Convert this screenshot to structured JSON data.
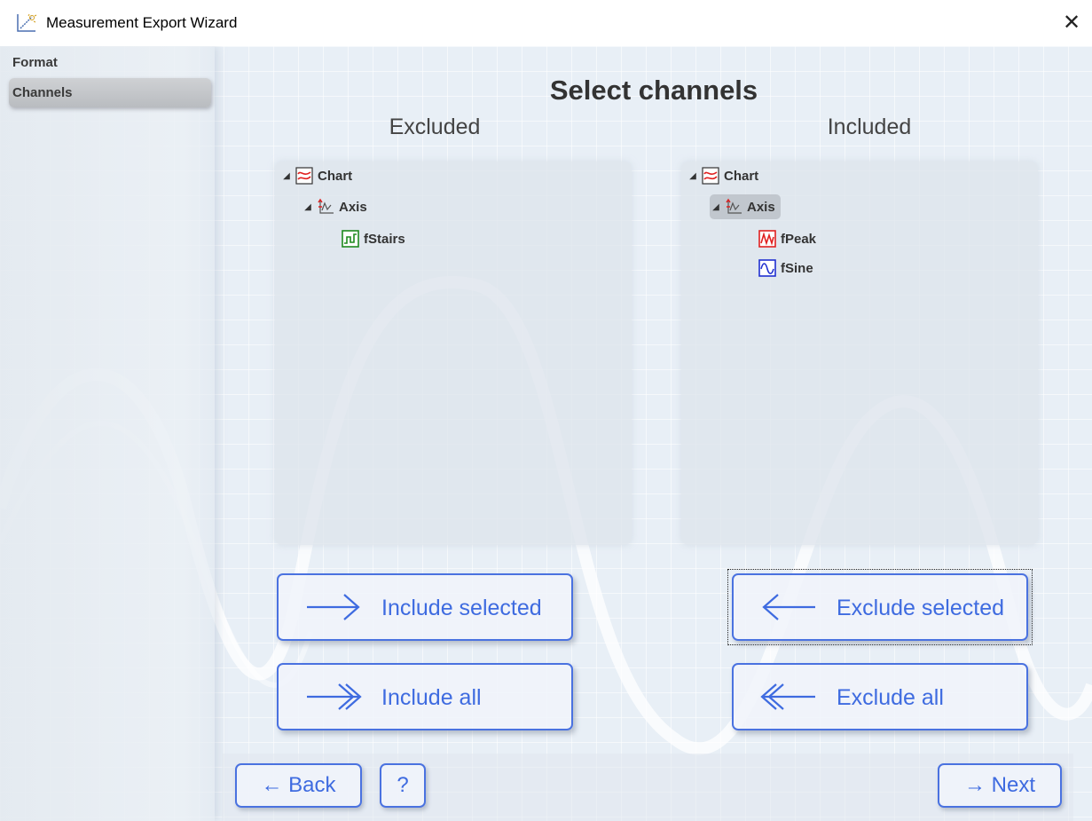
{
  "window": {
    "title": "Measurement Export Wizard",
    "close_glyph": "✕",
    "app_icon": "chart-wizard-icon"
  },
  "sidebar": {
    "items": [
      {
        "label": "Format",
        "active": false
      },
      {
        "label": "Channels",
        "active": true
      }
    ]
  },
  "main": {
    "title": "Select channels",
    "excluded_header": "Excluded",
    "included_header": "Included"
  },
  "excluded_tree": {
    "chart": {
      "label": "Chart",
      "expander": "◢",
      "icon": "chart-icon"
    },
    "axis": {
      "label": "Axis",
      "expander": "◢",
      "icon": "axis-icon"
    },
    "channels": [
      {
        "label": "fStairs",
        "icon": "channel-icon",
        "color": "#1e8a1e"
      }
    ]
  },
  "included_tree": {
    "chart": {
      "label": "Chart",
      "expander": "◢",
      "icon": "chart-icon"
    },
    "axis": {
      "label": "Axis",
      "expander": "◢",
      "icon": "axis-icon",
      "selected": true
    },
    "channels": [
      {
        "label": "fPeak",
        "icon": "channel-icon",
        "color": "#e02020"
      },
      {
        "label": "fSine",
        "icon": "channel-icon",
        "color": "#2030d0"
      }
    ]
  },
  "buttons": {
    "include_selected": "Include selected",
    "include_all": "Include all",
    "exclude_selected": "Exclude selected",
    "exclude_all": "Exclude all",
    "back": "← Back",
    "help": "?",
    "next": "→ Next"
  },
  "colors": {
    "accent": "#4a72e0",
    "accent_text": "#3e6be0",
    "background": "#e8eff6"
  }
}
